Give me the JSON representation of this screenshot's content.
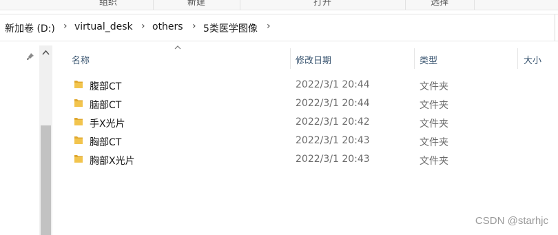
{
  "ribbon": {
    "groups": [
      "组织",
      "新建",
      "打开",
      "选择"
    ]
  },
  "address": {
    "crumbs": [
      "新加卷 (D:)",
      "virtual_desk",
      "others",
      "5类医学图像"
    ],
    "separator": "›"
  },
  "columns": {
    "name": "名称",
    "date": "修改日期",
    "type": "类型",
    "size": "大小"
  },
  "rows": [
    {
      "name": "腹部CT",
      "date": "2022/3/1 20:44",
      "type": "文件夹"
    },
    {
      "name": "脑部CT",
      "date": "2022/3/1 20:44",
      "type": "文件夹"
    },
    {
      "name": "手X光片",
      "date": "2022/3/1 20:42",
      "type": "文件夹"
    },
    {
      "name": "胸部CT",
      "date": "2022/3/1 20:43",
      "type": "文件夹"
    },
    {
      "name": "胸部X光片",
      "date": "2022/3/1 20:43",
      "type": "文件夹"
    }
  ],
  "watermark": "CSDN @starhjc",
  "colors": {
    "folder": "#f2c44d",
    "header_text": "#36526e"
  }
}
